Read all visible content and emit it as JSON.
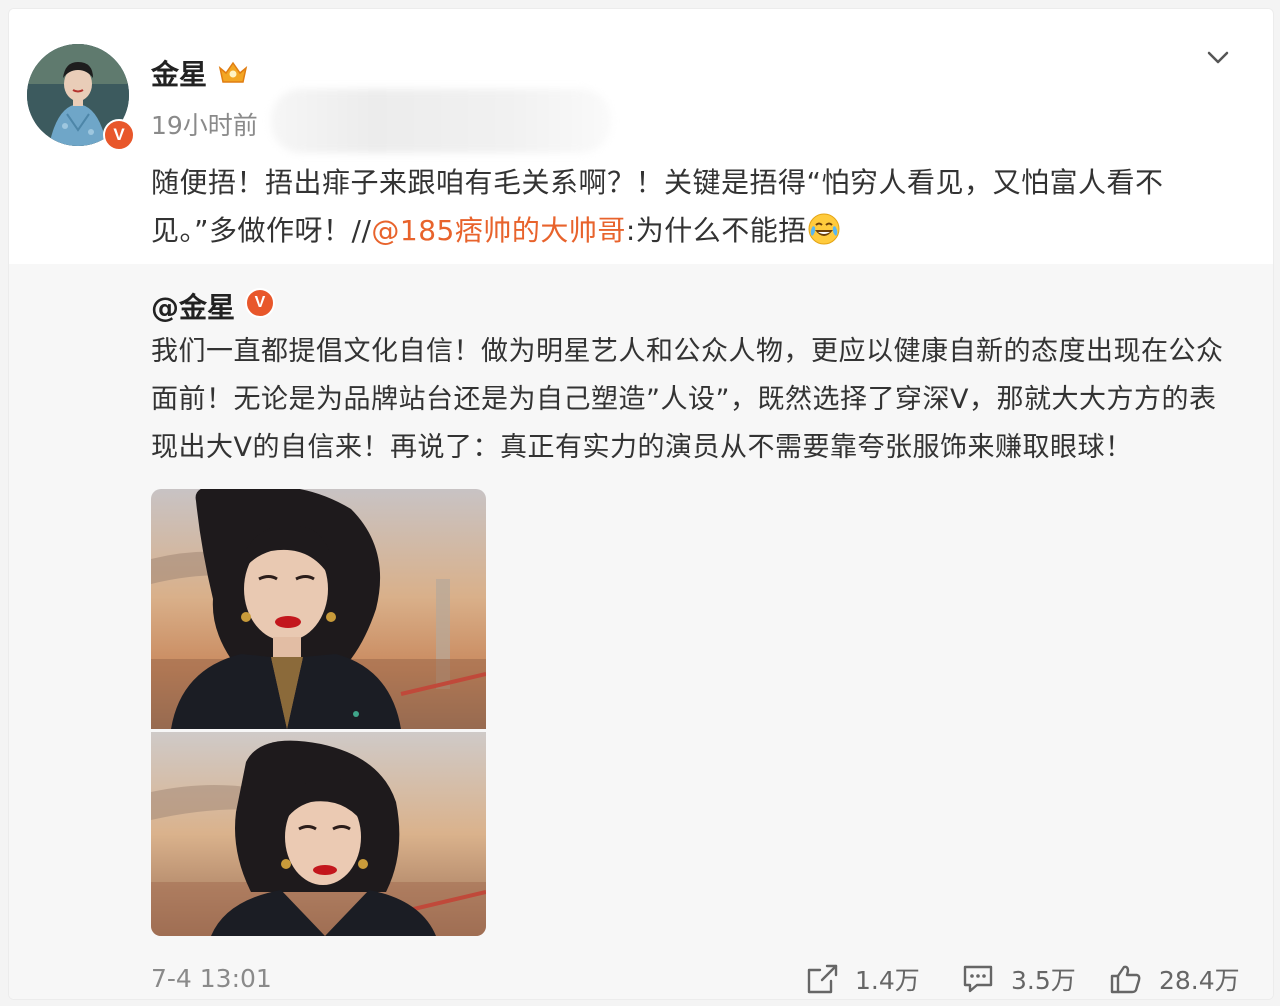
{
  "post": {
    "author": "金星",
    "time": "19小时前",
    "text_pre": "随便捂！捂出痱子来跟咱有毛关系啊？！关键是捂得“怕穷人看见，又怕富人看不见。”多做作呀！//",
    "mention": "@185痞帅的大帅哥",
    "text_post": ":为什么不能捂",
    "verified_badge": "V"
  },
  "repost": {
    "author": "@金星",
    "verified_badge": "V",
    "text": "我们一直都提倡文化自信！做为明星艺人和公众人物，更应以健康自新的态度出现在公众面前！无论是为品牌站台还是为自己塑造”人设”，既然选择了穿深V，那就大大方方的表现出大V的自信来！再说了：真正有实力的演员从不需要靠夸张服饰来赚取眼球！",
    "date": "7-4 13:01",
    "actions": {
      "share": "1.4万",
      "comment": "3.5万",
      "like": "28.4万"
    }
  },
  "icons": [
    "crown-icon",
    "chevron-down-icon",
    "laugh-cry-emoji",
    "share-icon",
    "comment-icon",
    "like-icon"
  ],
  "colors": {
    "mention": "#e8632c",
    "badge": "#e8572b",
    "muted": "#8a8a8a"
  }
}
